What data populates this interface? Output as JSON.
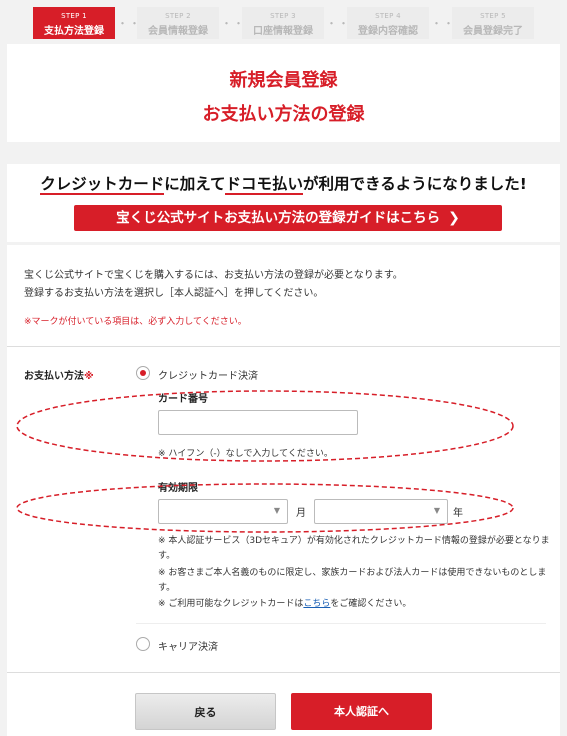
{
  "steps": [
    {
      "num": "STEP 1",
      "label": "支払方法登録"
    },
    {
      "num": "STEP 2",
      "label": "会員情報登録"
    },
    {
      "num": "STEP 3",
      "label": "口座情報登録"
    },
    {
      "num": "STEP 4",
      "label": "登録内容確認"
    },
    {
      "num": "STEP 5",
      "label": "会員登録完了"
    }
  ],
  "separator": "・・・",
  "title": {
    "line1": "新規会員登録",
    "line2": "お支払い方法の登録"
  },
  "banner": {
    "part1": "クレジットカード",
    "part2": "に加えて",
    "part3": "ドコモ払い",
    "part4": "が利用できるようになりました!",
    "guide_button": "宝くじ公式サイトお支払い方法の登録ガイドはこちら",
    "guide_chevron": "❯"
  },
  "intro": {
    "line1": "宝くじ公式サイトで宝くじを購入するには、お支払い方法の登録が必要となります。",
    "line2": "登録するお支払い方法を選択し［本人認証へ］を押してください。"
  },
  "required_note": {
    "mark": "※マーク",
    "text": "が付いている項目は、必ず入力してください。"
  },
  "payment": {
    "label": "お支払い方法",
    "required_mark": "※",
    "credit_label": "クレジットカード決済",
    "card_number_label": "カード番号",
    "card_number_note": "※ ハイフン（-）なしで入力してください。",
    "expiry_label": "有効期限",
    "month_unit": "月",
    "year_unit": "年",
    "note1": "※ 本人認証サービス（3Dセキュア）が有効化されたクレジットカード情報の登録が必要となります。",
    "note2": "※ お客さまご本人名義のものに限定し、家族カードおよび法人カードは使用できないものとします。",
    "note3_pre": "※ ご利用可能なクレジットカードは",
    "note3_link": "こちら",
    "note3_post": "をご確認ください。",
    "carrier_label": "キャリア決済"
  },
  "buttons": {
    "back": "戻る",
    "auth": "本人認証へ"
  },
  "colors": {
    "accent": "#d71e28",
    "link": "#1a5fb4"
  }
}
